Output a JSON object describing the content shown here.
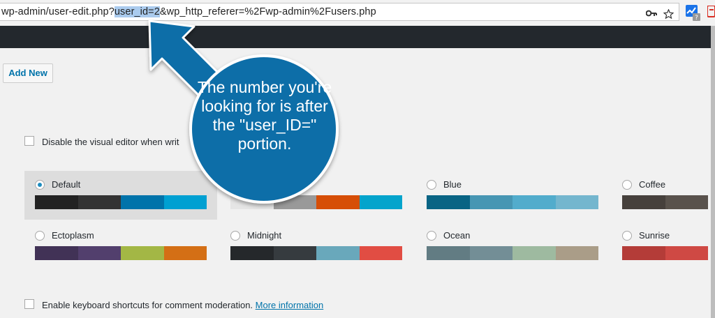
{
  "browser": {
    "url_before": "wp-admin/user-edit.php?",
    "url_selected": "user_id=2",
    "url_after": "&wp_http_referer=%2Fwp-admin%2Fusers.php",
    "icons": [
      "key-icon",
      "star-icon",
      "analytics-extension-icon",
      "pdf-extension-icon"
    ]
  },
  "page": {
    "add_new_label": "Add New",
    "visual_editor_label": "Disable the visual editor when writ",
    "keyboard_shortcuts_label": "Enable keyboard shortcuts for comment moderation.",
    "more_information_label": "More information"
  },
  "color_schemes": [
    {
      "name": "Default",
      "selected": true,
      "colors": [
        "#222222",
        "#333333",
        "#0073aa",
        "#00a0d2"
      ]
    },
    {
      "name": "",
      "selected": false,
      "colors": [
        "#e5e5e5",
        "#999999",
        "#d64e07",
        "#04a4cc"
      ]
    },
    {
      "name": "Blue",
      "selected": false,
      "colors": [
        "#096484",
        "#4796b3",
        "#52accc",
        "#74b6ce"
      ]
    },
    {
      "name": "Coffee",
      "selected": false,
      "colors": [
        "#46403c",
        "#59524c",
        "#c7a589",
        "#9ea476"
      ]
    },
    {
      "name": "Ectoplasm",
      "selected": false,
      "colors": [
        "#413256",
        "#523f6d",
        "#a3b745",
        "#d46f15"
      ]
    },
    {
      "name": "Midnight",
      "selected": false,
      "colors": [
        "#25282b",
        "#363b3f",
        "#69a8bb",
        "#e14d43"
      ]
    },
    {
      "name": "Ocean",
      "selected": false,
      "colors": [
        "#627c83",
        "#738e96",
        "#9ebaa0",
        "#aa9d88"
      ]
    },
    {
      "name": "Sunrise",
      "selected": false,
      "colors": [
        "#b43c38",
        "#cf4944",
        "#dd823b",
        "#ccaf0b"
      ]
    }
  ],
  "annotation": {
    "text": "The number you're looking for is after the \"user_ID=\" portion.",
    "color": "#0f6ea8"
  }
}
